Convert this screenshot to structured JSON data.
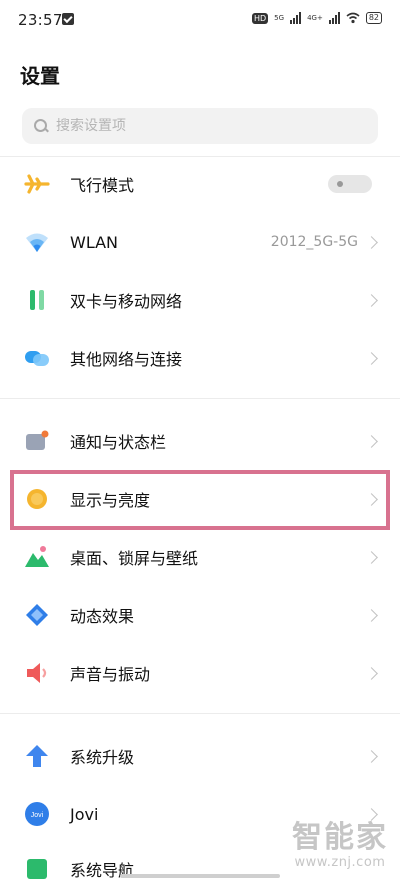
{
  "status_bar": {
    "time": "23:57",
    "hd_badge": "HD",
    "network_1": "5G",
    "network_2": "4G+",
    "battery": "82"
  },
  "page": {
    "title": "设置"
  },
  "search": {
    "placeholder": "搜索设置项"
  },
  "settings": {
    "airplane": {
      "label": "飞行模式",
      "toggle_on": false
    },
    "wlan": {
      "label": "WLAN",
      "value": "2012_5G-5G"
    },
    "dual_sim": {
      "label": "双卡与移动网络"
    },
    "other_networks": {
      "label": "其他网络与连接"
    },
    "notifications": {
      "label": "通知与状态栏"
    },
    "display": {
      "label": "显示与亮度"
    },
    "desktop": {
      "label": "桌面、锁屏与壁纸"
    },
    "animation": {
      "label": "动态效果"
    },
    "sound": {
      "label": "声音与振动"
    },
    "system_update": {
      "label": "系统升级"
    },
    "jovi": {
      "label": "Jovi",
      "icon_text": "Jovi"
    },
    "system_nav": {
      "label": "系统导航"
    }
  },
  "watermark": {
    "main": "智能家",
    "url": "www.znj.com"
  },
  "colors": {
    "highlight_border": "#d8728f",
    "airplane_icon": "#f5b52e",
    "wlan_icon": "#2f8cf0",
    "dual_sim_icon": "#2cba6c",
    "other_networks_icon": "#2f9ef0",
    "display_icon": "#f5b52e",
    "animation_icon": "#2f7ee8",
    "sound_icon": "#ef5a5a",
    "system_update_icon": "#3f86ee"
  }
}
